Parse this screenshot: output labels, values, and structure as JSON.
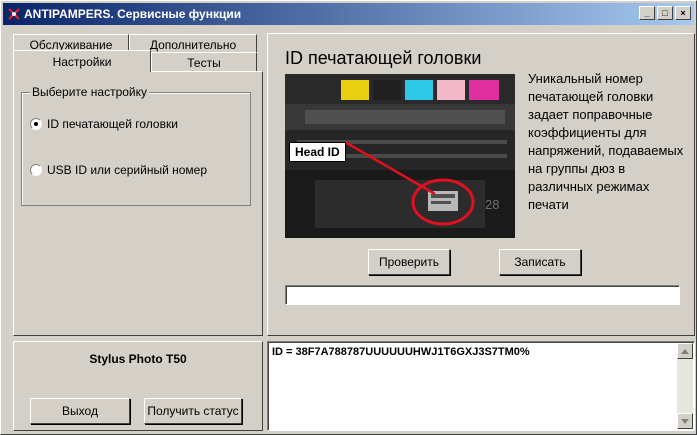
{
  "window": {
    "title": "ANTIPAMPERS. Сервисные функции",
    "minimize": "_",
    "maximize": "□",
    "close": "×"
  },
  "tabs": {
    "row1": [
      {
        "label": "Обслуживание"
      },
      {
        "label": "Дополнительно"
      }
    ],
    "row2": [
      {
        "label": "Настройки"
      },
      {
        "label": "Тесты"
      }
    ]
  },
  "settings": {
    "group_label": "Выберите настройку",
    "options": [
      {
        "label": "ID печатающей головки",
        "selected": true
      },
      {
        "label": "USB ID или серийный номер",
        "selected": false
      }
    ]
  },
  "main": {
    "heading": "ID печатающей головки",
    "image_label": "Head ID",
    "image_number": "28",
    "description": "Уникальный номер печатающей головки задает поправочные коэффициенты для напряжений, подаваемых на группы дюз в различных режимах печати",
    "check_button": "Проверить",
    "write_button": "Записать",
    "input_value": ""
  },
  "bottom_left": {
    "printer_model": "Stylus Photo T50",
    "exit_button": "Выход",
    "status_button": "Получить статус"
  },
  "log": {
    "text": "ID = 38F7A788787UUUUUUHWJ1T6GXJ3S7TM0%"
  },
  "colors": {
    "title_start": "#0a246a",
    "title_end": "#a6caf0",
    "face": "#d4d0c8",
    "highlight_red": "#e01020"
  }
}
